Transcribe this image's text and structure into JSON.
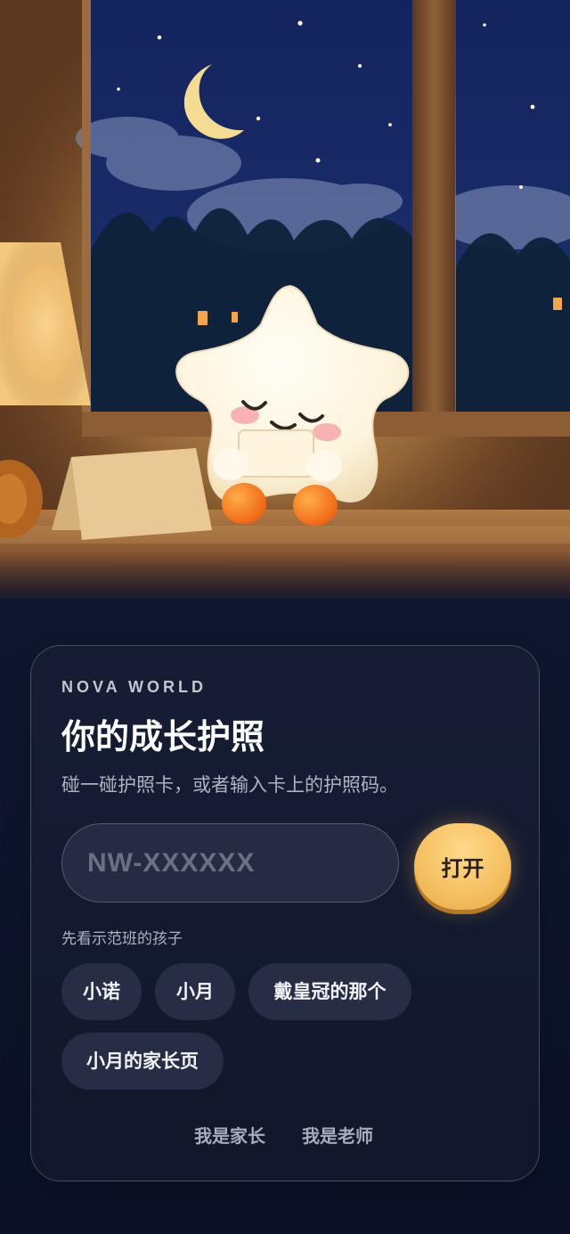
{
  "app": {
    "brand": "NOVA WORLD",
    "title": "你的成长护照",
    "subtitle": "碰一碰护照卡，或者输入卡上的护照码。"
  },
  "passport_form": {
    "placeholder": "NW-XXXXXX",
    "value": "",
    "open_label": "打开"
  },
  "demo_section": {
    "label": "先看示范班的孩子",
    "chips": [
      {
        "label": "小诺"
      },
      {
        "label": "小月"
      },
      {
        "label": "戴皇冠的那个"
      },
      {
        "label": "小月的家长页"
      }
    ]
  },
  "footer": {
    "parent_label": "我是家长",
    "teacher_label": "我是老师"
  },
  "icons": {
    "hero": "sleeping-star-illustration",
    "moon": "moon-icon"
  },
  "colors": {
    "background": "#0f1730",
    "card": "#161d34",
    "input": "#242b43",
    "chip": "#262d45",
    "accent": "#f5c062",
    "text": "#ffffff",
    "muted_text": "#aeb3c2"
  }
}
